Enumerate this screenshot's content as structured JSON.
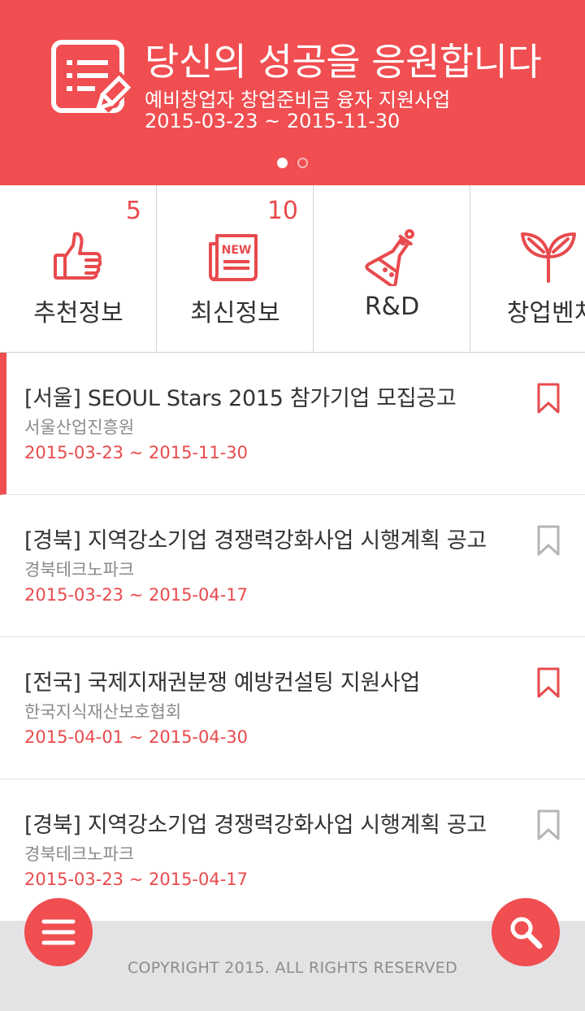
{
  "banner": {
    "title": "당신의 성공을 응원합니다",
    "subtitle": "예비창업자 창업준비금 융자 지원사업",
    "period": "2015-03-23 ~ 2015-11-30",
    "slides_total": 2,
    "slide_active": 1,
    "icon": "document-edit-icon"
  },
  "categories": [
    {
      "label": "추천정보",
      "count": "5",
      "icon": "thumbs-up-icon"
    },
    {
      "label": "최신정보",
      "count": "10",
      "icon": "newspaper-new-icon"
    },
    {
      "label": "R&D",
      "count": "",
      "icon": "flask-icon"
    },
    {
      "label": "창업벤처",
      "count": "",
      "icon": "sprout-icon"
    }
  ],
  "items": [
    {
      "title": "[서울] SEOUL Stars 2015 참가기업 모집공고",
      "org": "서울산업진흥원",
      "date": "2015-03-23 ~ 2015-11-30",
      "bookmarked": true
    },
    {
      "title": "[경북] 지역강소기업 경쟁력강화사업 시행계획 공고",
      "org": "경북테크노파크",
      "date": "2015-03-23 ~ 2015-04-17",
      "bookmarked": false
    },
    {
      "title": "[전국] 국제지재권분쟁 예방컨설팅 지원사업",
      "org": "한국지식재산보호협회",
      "date": "2015-04-01 ~ 2015-04-30",
      "bookmarked": true
    },
    {
      "title": "[경북] 지역강소기업 경쟁력강화사업 시행계획 공고",
      "org": "경북테크노파크",
      "date": "2015-03-23 ~ 2015-04-17",
      "bookmarked": false
    }
  ],
  "footer": {
    "copyright": "COPYRIGHT 2015. ALL RIGHTS RESERVED"
  },
  "colors": {
    "accent": "#f04e51",
    "bookmark_inactive": "#b5b5b5",
    "footer_bg": "#e3e3e6"
  }
}
